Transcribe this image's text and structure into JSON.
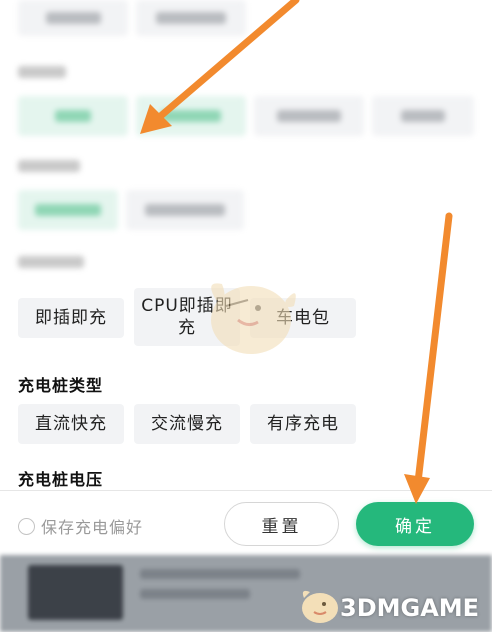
{
  "blurred": {
    "top_chips": [
      "",
      ""
    ],
    "label_1": "",
    "row1": [
      "",
      "",
      "",
      ""
    ],
    "label_2": "",
    "row2": [
      "",
      ""
    ],
    "label_3": ""
  },
  "plug_type": {
    "options": [
      "即插即充",
      "CPU即插即充",
      "车电包"
    ]
  },
  "pile_type": {
    "title": "充电桩类型",
    "options": [
      "直流快充",
      "交流慢充",
      "有序充电"
    ]
  },
  "pile_voltage": {
    "title": "充电桩电压"
  },
  "footer": {
    "save_pref_label": "保存充电偏好",
    "reset_label": "重置",
    "confirm_label": "确定"
  },
  "watermark": {
    "text": "3DMGAME"
  },
  "colors": {
    "accent": "#25b87c",
    "arrow": "#f28a2e",
    "chip_bg": "#f2f3f5"
  }
}
